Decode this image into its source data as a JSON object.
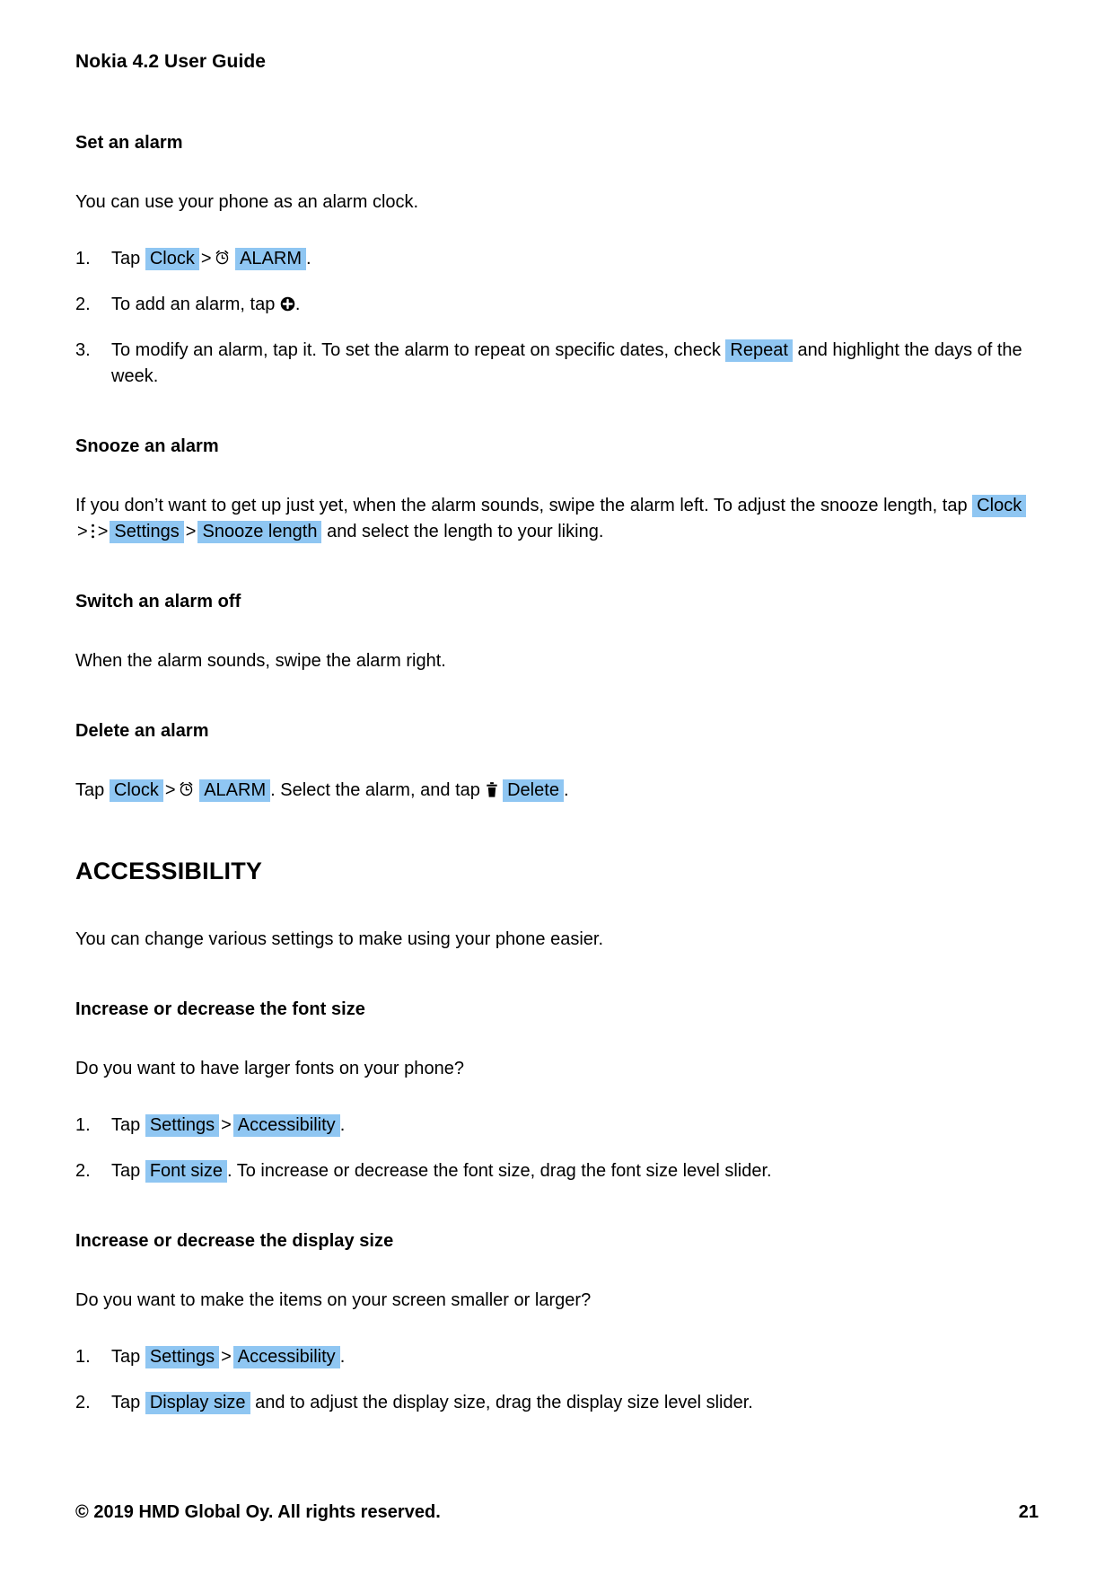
{
  "header": {
    "title": "Nokia 4.2 User Guide"
  },
  "sections": {
    "set_alarm": {
      "heading": "Set an alarm",
      "intro": "You can use your phone as an alarm clock.",
      "step1": {
        "pre": "Tap",
        "ref_clock": "Clock",
        "sep": ">",
        "icon": "alarm-clock-icon",
        "ref_alarm": "ALARM",
        "post": "."
      },
      "step2": {
        "pre": "To add an alarm, tap",
        "icon": "add-circle-icon",
        "post": "."
      },
      "step3": {
        "pre": "To modify an alarm, tap it. To set the alarm to repeat on specific dates, check",
        "ref_repeat": "Repeat",
        "post": "and highlight the days of the week."
      }
    },
    "snooze_alarm": {
      "heading": "Snooze an alarm",
      "text_part1": "If you don’t want to get up just yet, when the alarm sounds, swipe the alarm left. To adjust the snooze length, tap",
      "ref_clock": "Clock",
      "sep1": ">",
      "icon": "overflow-menu-icon",
      "sep2": ">",
      "ref_settings": "Settings",
      "sep3": ">",
      "ref_snooze_length": "Snooze length",
      "text_part2": "and select the length to your liking."
    },
    "switch_alarm_off": {
      "heading": "Switch an alarm off",
      "text": "When the alarm sounds, swipe the alarm right."
    },
    "delete_alarm": {
      "heading": "Delete an alarm",
      "pre": "Tap",
      "ref_clock": "Clock",
      "sep": ">",
      "icon_alarm": "alarm-clock-icon",
      "ref_alarm": "ALARM",
      "mid": ". Select the alarm, and tap",
      "icon_trash": "trash-icon",
      "ref_delete": "Delete",
      "post": "."
    },
    "accessibility": {
      "heading": "ACCESSIBILITY",
      "intro": "You can change various settings to make using your phone easier."
    },
    "font_size": {
      "heading": "Increase or decrease the font size",
      "intro": "Do you want to have larger fonts on your phone?",
      "step1": {
        "pre": "Tap",
        "ref_settings": "Settings",
        "sep": ">",
        "ref_accessibility": "Accessibility",
        "post": "."
      },
      "step2": {
        "pre": "Tap",
        "ref_font_size": "Font size",
        "post": ". To increase or decrease the font size, drag the font size level slider."
      }
    },
    "display_size": {
      "heading": "Increase or decrease the display size",
      "intro": "Do you want to make the items on your screen smaller or larger?",
      "step1": {
        "pre": "Tap",
        "ref_settings": "Settings",
        "sep": ">",
        "ref_accessibility": "Accessibility",
        "post": "."
      },
      "step2": {
        "pre": "Tap",
        "ref_display_size": "Display size",
        "post": "and to adjust the display size, drag the display size level slider."
      }
    }
  },
  "footer": {
    "copyright": "© 2019 HMD Global Oy. All rights reserved.",
    "page_number": "21"
  },
  "colors": {
    "highlight": "#8fc6f2",
    "text": "#000000",
    "background": "#ffffff"
  }
}
